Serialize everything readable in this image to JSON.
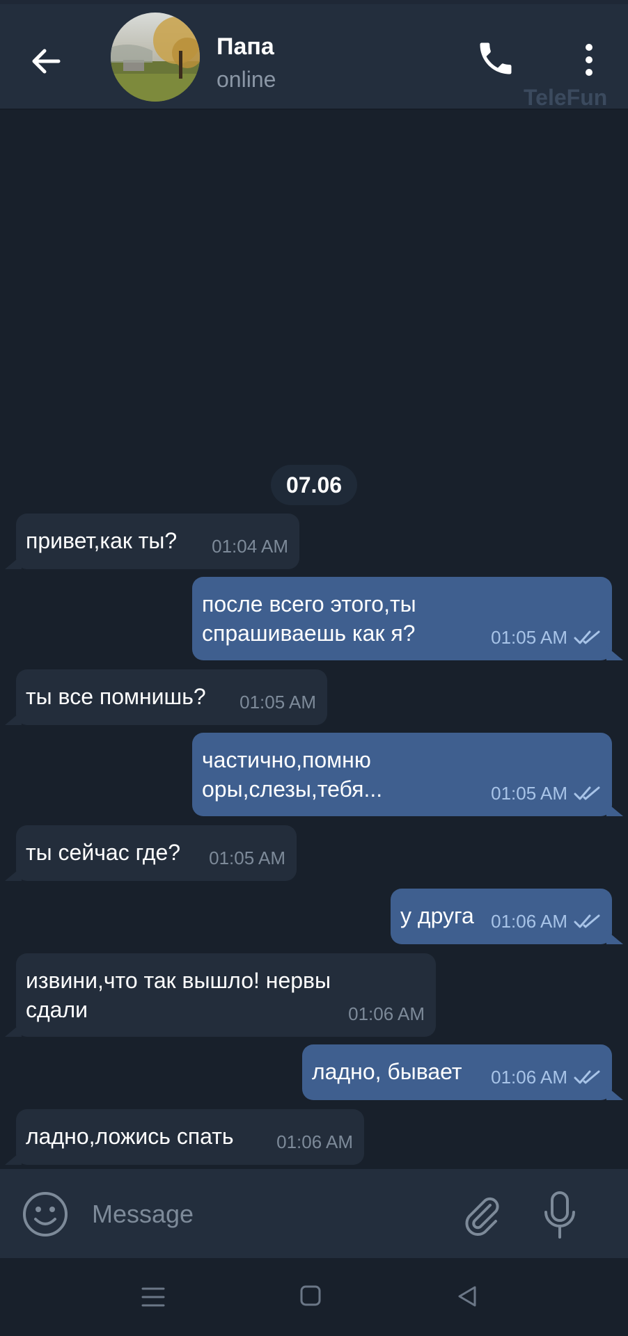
{
  "header": {
    "contact_name": "Папа",
    "status": "online",
    "watermark": "TeleFun"
  },
  "icons": {
    "back": "back-arrow-icon",
    "avatar": "avatar",
    "call": "phone-icon",
    "menu": "more-vertical-icon",
    "emoji": "emoji-icon",
    "attach": "paperclip-icon",
    "mic": "microphone-icon",
    "read": "double-check-icon"
  },
  "chat": {
    "date_label": "07.06",
    "messages": [
      {
        "direction": "in",
        "text": "привет,как ты?",
        "time": "01:04 AM"
      },
      {
        "direction": "out",
        "text": "после всего этого,ты\nспрашиваешь как я?",
        "time": "01:05 AM",
        "read": true
      },
      {
        "direction": "in",
        "text": "ты все помнишь?",
        "time": "01:05 AM"
      },
      {
        "direction": "out",
        "text": "частично,помню\nоры,слезы,тебя...",
        "time": "01:05 AM",
        "read": true
      },
      {
        "direction": "in",
        "text": "ты сейчас где?",
        "time": "01:05 AM"
      },
      {
        "direction": "out",
        "text": "у друга",
        "time": "01:06 AM",
        "read": true
      },
      {
        "direction": "in",
        "text": "извини,что так вышло! нервы\nсдали",
        "time": "01:06 AM"
      },
      {
        "direction": "out",
        "text": "ладно, бывает",
        "time": "01:06 AM",
        "read": true
      },
      {
        "direction": "in",
        "text": "ладно,ложись спать",
        "time": "01:06 AM"
      }
    ]
  },
  "input": {
    "placeholder": "Message",
    "value": ""
  },
  "colors": {
    "background": "#18202b",
    "header": "#232e3d",
    "incoming_bubble": "#232d3b",
    "outgoing_bubble": "#3f5f8f",
    "accent": "#a8c4e8"
  }
}
